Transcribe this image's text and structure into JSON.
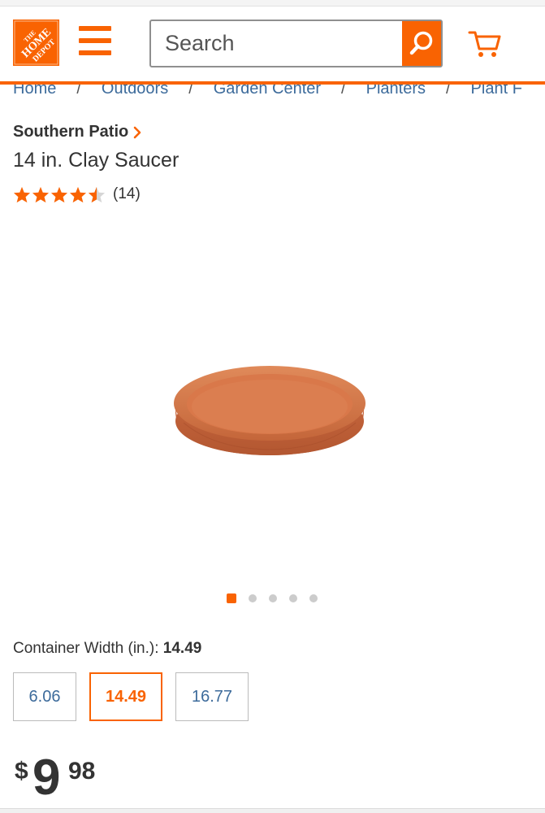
{
  "header": {
    "logo_text": "THE HOME DEPOT",
    "search_placeholder": "Search",
    "brand_color": "#f96302"
  },
  "breadcrumb": [
    "Home",
    "Outdoors",
    "Garden Center",
    "Planters",
    "Plant F"
  ],
  "product": {
    "brand": "Southern Patio",
    "title": "14 in. Clay Saucer",
    "rating": 4.5,
    "rating_max": 5,
    "review_count": "(14)"
  },
  "gallery": {
    "image_count": 5,
    "active_index": 0
  },
  "options": {
    "label": "Container Width (in.):",
    "selected_value": "14.49",
    "swatches": [
      "6.06",
      "14.49",
      "16.77"
    ]
  },
  "price": {
    "currency": "$",
    "dollars": "9",
    "cents": "98"
  },
  "icons": {
    "menu": "hamburger-icon",
    "search": "search-icon",
    "cart": "cart-icon",
    "chevron": "chevron-right-icon",
    "star": "star-icon"
  }
}
